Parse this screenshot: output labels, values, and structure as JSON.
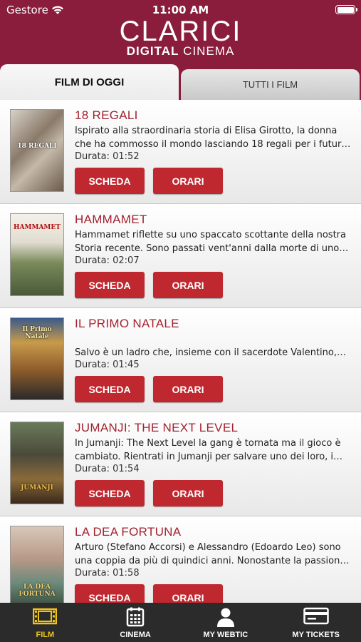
{
  "status_bar": {
    "carrier": "Gestore",
    "time": "11:00 AM"
  },
  "logo": {
    "title": "CLARICI",
    "subtitle_bold": "DIGITAL",
    "subtitle_light": "CINEMA"
  },
  "tabs": [
    {
      "label": "FILM DI OGGI",
      "active": true
    },
    {
      "label": "TUTTI I FILM",
      "active": false
    }
  ],
  "movies": [
    {
      "title": "18 REGALI",
      "desc_line1": "Ispirato alla straordinaria storia di Elisa Girotto, la donna",
      "desc_line2": "che ha commosso il mondo lasciando 18 regali per i futur…",
      "duration": "Durata: 01:52",
      "poster_text": "18 REGALI",
      "scheda_label": "SCHEDA",
      "orari_label": "ORARI"
    },
    {
      "title": "HAMMAMET",
      "desc_line1": "Hammamet riflette su uno spaccato scottante della nostra",
      "desc_line2": "Storia recente. Sono passati vent'anni dalla morte di uno…",
      "duration": "Durata: 02:07",
      "poster_text": "HAMMAMET",
      "scheda_label": "SCHEDA",
      "orari_label": "ORARI"
    },
    {
      "title": "IL PRIMO NATALE",
      "desc_line1": "",
      "desc_line2": "Salvo è un ladro che, insieme con il sacerdote Valentino,…",
      "duration": "Durata: 01:45",
      "poster_text": "Il Primo Natale",
      "scheda_label": "SCHEDA",
      "orari_label": "ORARI"
    },
    {
      "title": "JUMANJI: THE NEXT LEVEL",
      "desc_line1": "In Jumanji: The Next Level la gang è tornata ma il gioco è",
      "desc_line2": "cambiato. Rientrati in Jumanji per salvare uno dei loro, i…",
      "duration": "Durata: 01:54",
      "poster_text": "JUMANJI",
      "scheda_label": "SCHEDA",
      "orari_label": "ORARI"
    },
    {
      "title": "LA DEA FORTUNA",
      "desc_line1": "Arturo (Stefano Accorsi) e Alessandro (Edoardo Leo) sono",
      "desc_line2": "una coppia da più di quindici anni. Nonostante la passion…",
      "duration": "Durata: 01:58",
      "poster_text": "LA DEA FORTUNA",
      "scheda_label": "SCHEDA",
      "orari_label": "ORARI"
    }
  ],
  "bottom_nav": [
    {
      "label": "FILM",
      "icon": "film-icon",
      "active": true
    },
    {
      "label": "CINEMA",
      "icon": "calendar-icon",
      "active": false
    },
    {
      "label": "MY WEBTIC",
      "icon": "user-icon",
      "active": false
    },
    {
      "label": "MY TICKETS",
      "icon": "ticket-icon",
      "active": false
    }
  ],
  "colors": {
    "brand": "#8a1c3c",
    "button": "#c0282f",
    "title": "#a3222f",
    "nav_active": "#f0c419",
    "nav_bg": "#2b2b2b"
  }
}
